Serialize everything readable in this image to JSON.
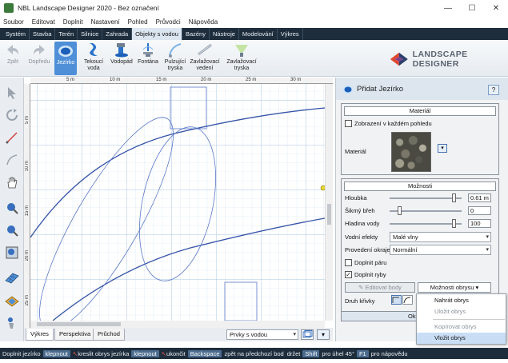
{
  "window": {
    "title": "NBL Landscape Designer 2020 - Bez označení",
    "controls": {
      "minimize": "—",
      "maximize": "☐",
      "close": "✕"
    }
  },
  "menu": [
    "Soubor",
    "Editovat",
    "Doplnit",
    "Nastavení",
    "Pohled",
    "Průvodci",
    "Nápověda"
  ],
  "tabs": [
    "Systém",
    "Stavba",
    "Terén",
    "Silnice",
    "Zahrada",
    "Objekty s vodou",
    "Bazény",
    "Nástroje",
    "Modelování",
    "Výkres"
  ],
  "active_tab": "Objekty s vodou",
  "ribbon": {
    "back": "Zpět",
    "forward": "Dopředu",
    "items": [
      {
        "label": "Jezírko",
        "icon": "pond-icon"
      },
      {
        "label": "Tekoucí voda",
        "icon": "stream-icon"
      },
      {
        "label": "Vodopád",
        "icon": "waterfall-icon"
      },
      {
        "label": "Fontána",
        "icon": "fountain-icon"
      },
      {
        "label": "Pulzující tryska",
        "icon": "pulse-nozzle-icon"
      },
      {
        "label": "Zavlažovací vedení",
        "icon": "irrigation-line-icon"
      },
      {
        "label": "Zavlažovací tryska",
        "icon": "sprinkler-icon"
      }
    ]
  },
  "logo": {
    "text": "LANDSCAPE DESIGNER"
  },
  "ruler": {
    "top_marks": [
      "5 m",
      "10 m",
      "15 m",
      "20 m",
      "25 m",
      "30 m"
    ],
    "left_marks": [
      "5 m",
      "10 m",
      "15 m",
      "20 m",
      "25 m"
    ]
  },
  "view_tabs": [
    "Výkres",
    "Perspektiva",
    "Průchod"
  ],
  "view_select": "Prvky s vodou",
  "panel": {
    "title": "Přidat Jezírko",
    "help": "?",
    "material_section": {
      "title": "Materiál",
      "show_in_each_view": "Zobrazení v každém pohledu",
      "material_label": "Materiál"
    },
    "options_section": {
      "title": "Možnosti",
      "depth_label": "Hloubka",
      "depth_value": "0.61 m",
      "slope_label": "Šikmý břeh",
      "slope_value": "0",
      "water_level_label": "Hladina vody",
      "water_level_value": "100",
      "water_effects_label": "Vodní efekty",
      "water_effects_value": "Malé vlny",
      "edge_label": "Provedení okraje",
      "edge_value": "Normální",
      "add_steam": "Doplnit páru",
      "add_fish": "Doplnit ryby",
      "edit_points": "Editovat body",
      "outline_options": "Možnosti obrysu",
      "curve_type_label": "Druh křivky",
      "bottom_button": "Okraj z..."
    }
  },
  "dropdown": [
    "Nahrát obrys",
    "Uložit obrys",
    "Kopírovat obrys",
    "Vložit obrys"
  ],
  "status": {
    "prefix": "Doplnit jezírko",
    "click1": "klepnout",
    "text1": "kreslit obrys jezírka",
    "click2": "klepnout",
    "text2": "ukončit",
    "key1": "Backspace",
    "text3": "zpět na předchozí bod",
    "text4": "držet",
    "key2": "Shift",
    "text5": "pro úhel 45°",
    "key3": "F1",
    "text6": "pro nápovědu"
  },
  "colors": {
    "accent": "#4e8fd8",
    "dark_bar": "#1e2d3c",
    "curve": "#3553a8"
  }
}
